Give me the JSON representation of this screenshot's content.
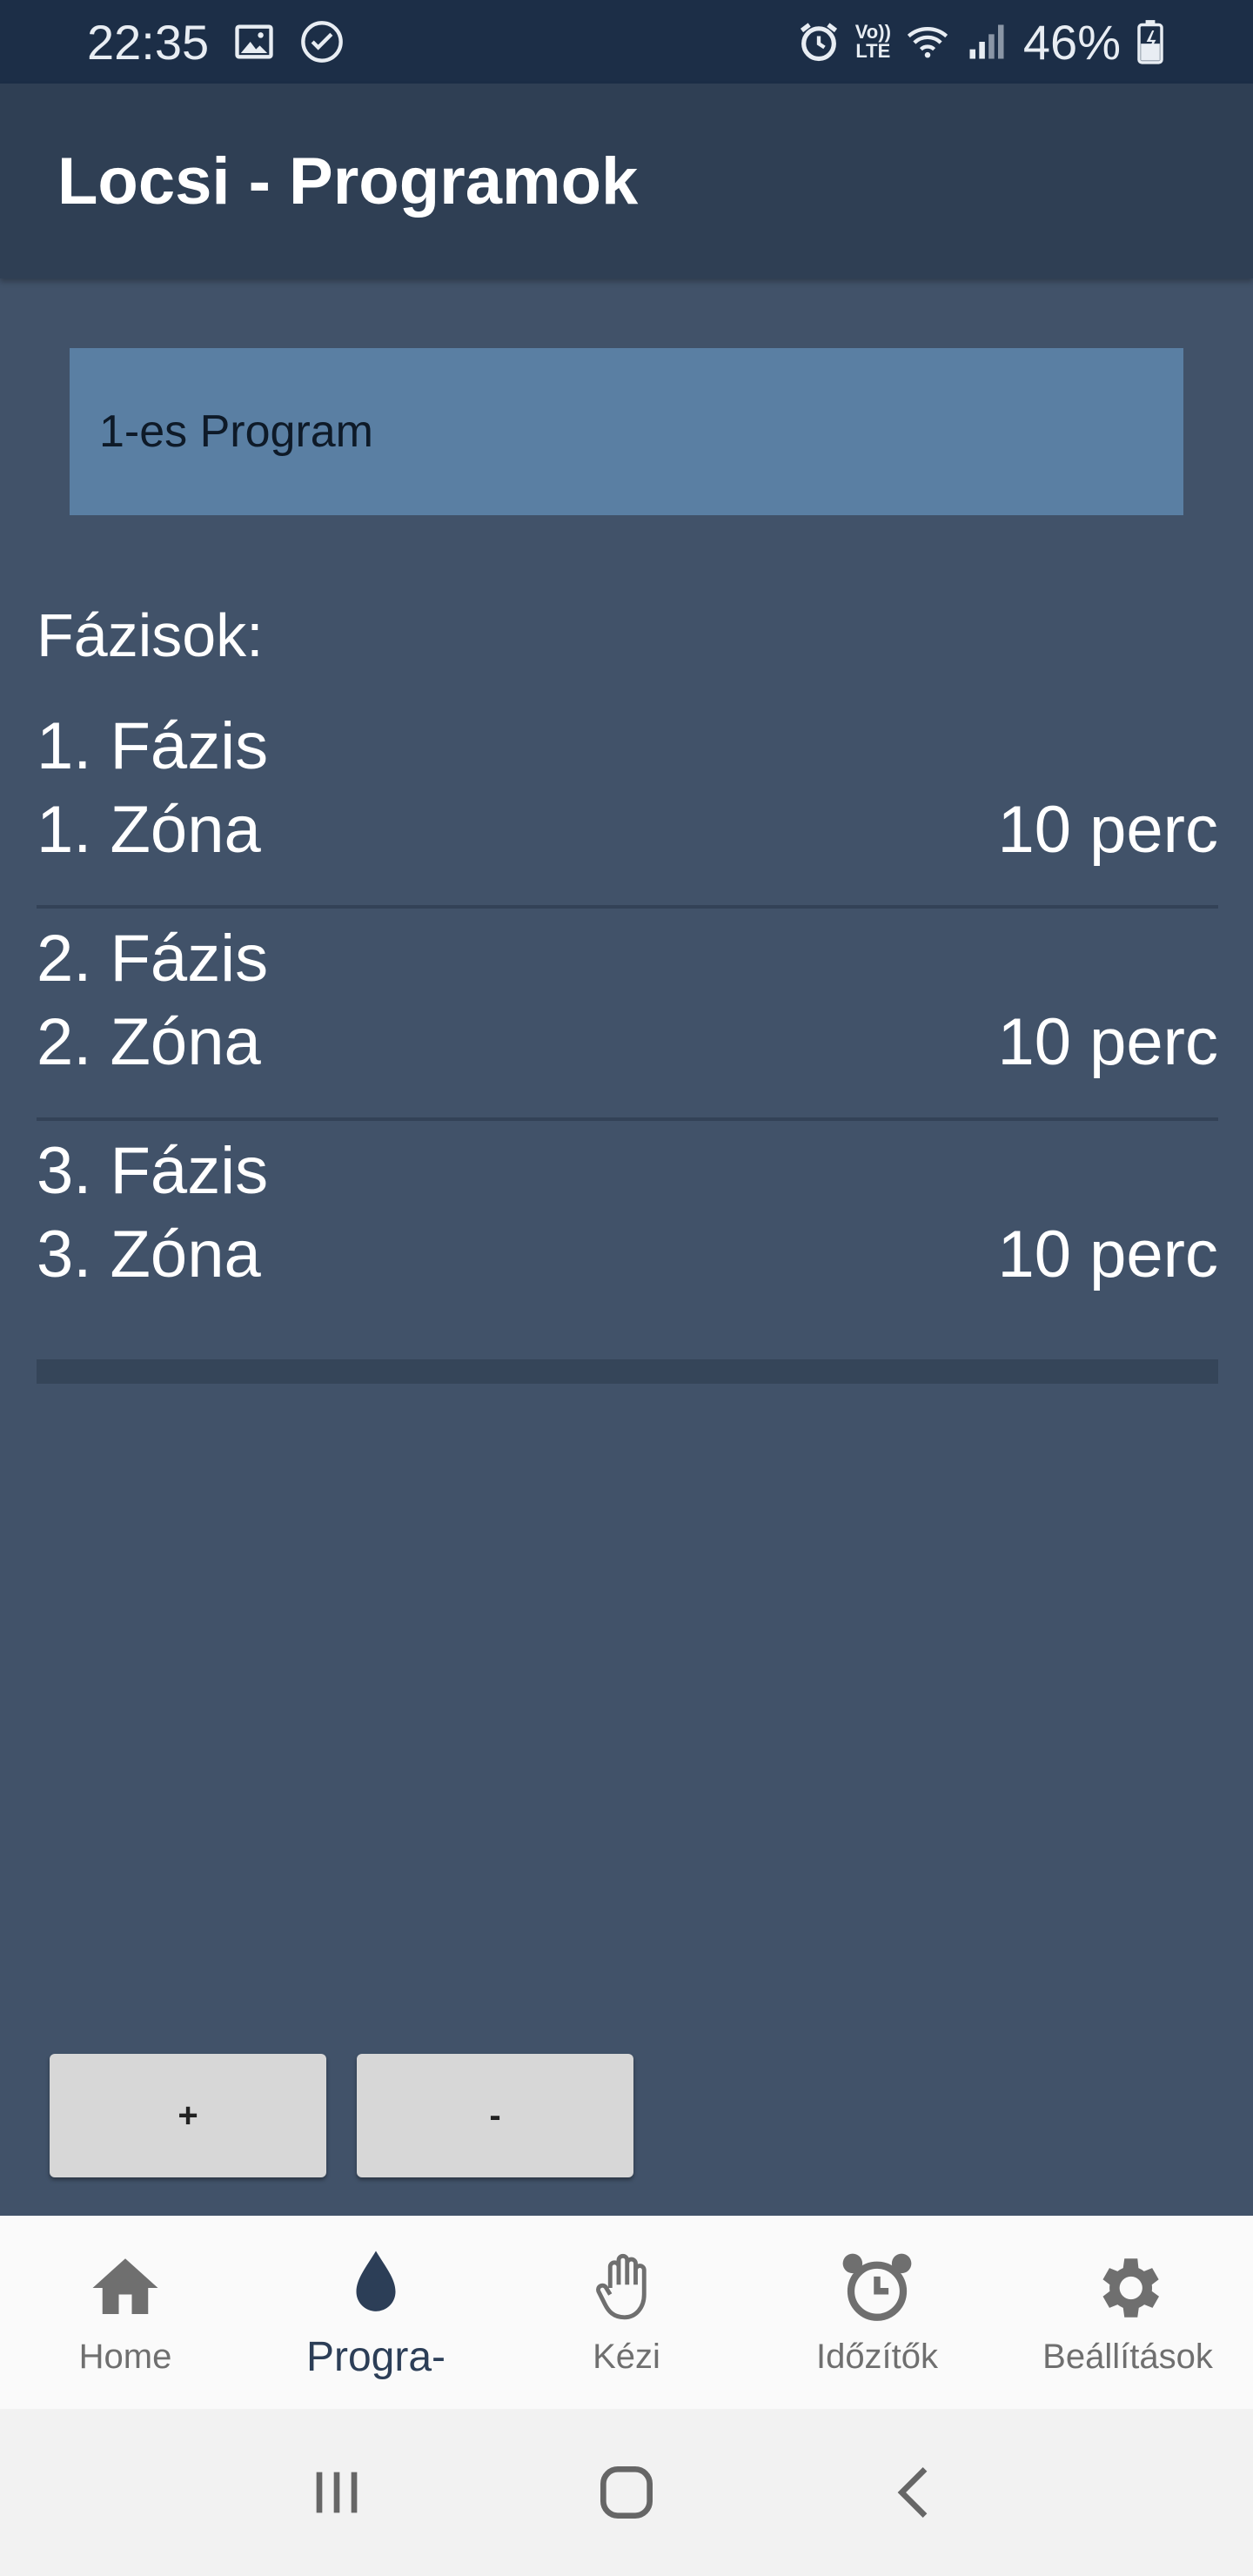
{
  "status_bar": {
    "time": "22:35",
    "lte_top": "Vo))",
    "lte_bottom": "LTE",
    "battery": "46%"
  },
  "app_bar": {
    "title": "Locsi - Programok"
  },
  "program_selector": {
    "value": "1-es Program"
  },
  "phases": {
    "title": "Fázisok:",
    "items": [
      {
        "phase": "1. Fázis",
        "zone": "1. Zóna",
        "duration": "10 perc"
      },
      {
        "phase": "2. Fázis",
        "zone": "2. Zóna",
        "duration": "10 perc"
      },
      {
        "phase": "3. Fázis",
        "zone": "3. Zóna",
        "duration": "10 perc"
      }
    ]
  },
  "buttons": {
    "add": "+",
    "remove": "-"
  },
  "bottom_nav": {
    "items": [
      {
        "label": "Home",
        "icon": "home-icon",
        "active": false
      },
      {
        "label": "Progra-",
        "icon": "water-drop-icon",
        "active": true
      },
      {
        "label": "Kézi",
        "icon": "hand-icon",
        "active": false
      },
      {
        "label": "Időzítők",
        "icon": "alarm-clock-icon",
        "active": false
      },
      {
        "label": "Beállítások",
        "icon": "gear-icon",
        "active": false
      }
    ]
  },
  "colors": {
    "background": "#415269",
    "app_bar": "#2f3f54",
    "status_bar": "#1c2e47",
    "selector": "#5a7fa3"
  }
}
